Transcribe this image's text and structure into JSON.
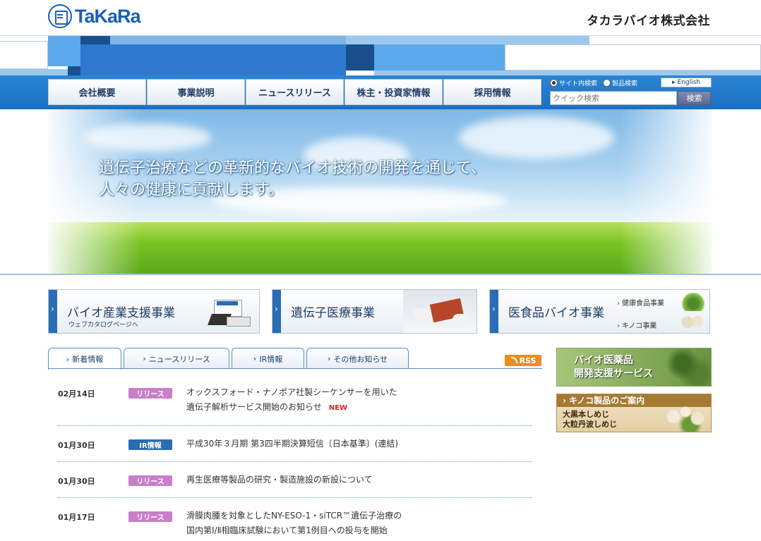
{
  "header": {
    "logo_text": "TaKaRa",
    "company_name": "タカラバイオ株式会社"
  },
  "nav": {
    "items": [
      "会社概要",
      "事業説明",
      "ニュースリリース",
      "株主・投資家情報",
      "採用情報"
    ]
  },
  "search": {
    "radio_site": "サイト内検索",
    "radio_product": "製品検索",
    "english": "English",
    "placeholder": "クイック検索",
    "button": "検索"
  },
  "hero": {
    "line1": "遺伝子治療などの革新的なバイオ技術の開発を通じて、",
    "line2": "人々の健康に貢献します。"
  },
  "banners": [
    {
      "title": "バイオ産業支援事業",
      "sub": "ウェブカタログページへ"
    },
    {
      "title": "遺伝子医療事業"
    },
    {
      "title": "医食品バイオ事業",
      "links": [
        "健康食品事業",
        "キノコ事業"
      ]
    }
  ],
  "tabs": [
    "新着情報",
    "ニュースリリース",
    "IR情報",
    "その他お知らせ"
  ],
  "rss": "RSS",
  "news": [
    {
      "date": "02月14日",
      "badge": "リリース",
      "line1": "オックスフォード・ナノポア社製シーケンサーを用いた",
      "line2": "遺伝子解析サービス開始のお知らせ",
      "tag": "NEW"
    },
    {
      "date": "01月30日",
      "badge": "IR情報",
      "line1": "平成30年３月期 第3四半期決算短信〔日本基準〕(連結)"
    },
    {
      "date": "01月30日",
      "badge": "リリース",
      "line1": "再生医療等製品の研究・製造施設の新設について"
    },
    {
      "date": "01月17日",
      "badge": "リリース",
      "line1": "滑膜肉腫を対象としたNY-ESO-1・siTCR™遺伝子治療の",
      "line2": "国内第Ⅰ/Ⅱ相臨床試験において第1例目への投与を開始"
    }
  ],
  "side": {
    "banner1_line1": "バイオ医薬品",
    "banner1_line2": "開発支援サービス",
    "banner2_head": "キノコ製品のご案内",
    "banner2_line1": "大黒本しめじ",
    "banner2_line2": "大粒丹波しめじ"
  },
  "colors": {
    "brand": "#1b5fb0",
    "badge_release": "#c87fc8",
    "badge_ir": "#2a6cb6",
    "new": "#e02020",
    "rss": "#f08c1a"
  }
}
